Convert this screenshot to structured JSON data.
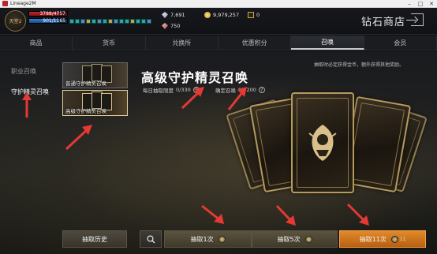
{
  "window": {
    "title": "Lineage2M"
  },
  "player": {
    "hp_text": "3788/4757",
    "hp_ratio": 0.8,
    "mp_text": "901/1165",
    "mp_ratio": 0.77,
    "avatar_text": "天堂2"
  },
  "currencies": {
    "diamond_blue": "7,691",
    "diamond_red": "750",
    "gold": "9,979,257",
    "chest": "0"
  },
  "shop": {
    "title": "钻石商店"
  },
  "tabs": [
    "商品",
    "货币",
    "兑换所",
    "优惠积分",
    "召唤",
    "会员"
  ],
  "active_tab": "召唤",
  "sidebar": {
    "items": [
      "职业召唤",
      "守护精灵召唤"
    ]
  },
  "summon_options": [
    {
      "label": "普通守护精灵召唤"
    },
    {
      "label": "高级守护精灵召唤"
    }
  ],
  "main": {
    "title": "高级守护精灵召唤",
    "daily_limit_label": "每日抽取限度",
    "daily_limit_value": "0/330",
    "guarantee_label": "确定召唤",
    "guarantee_value": "83/200",
    "help": "?",
    "notice": "抽取时必定获得金币，额外获得其他奖励。"
  },
  "buttons": {
    "history": "抽取历史",
    "draw1": "抽取1次",
    "draw5": "抽取5次",
    "draw11": "抽取11次",
    "draw11_cost": "11"
  },
  "colors": {
    "accent_orange": "#e28a2a",
    "gold_border": "#b59a5c",
    "arrow_red": "#e53935"
  }
}
